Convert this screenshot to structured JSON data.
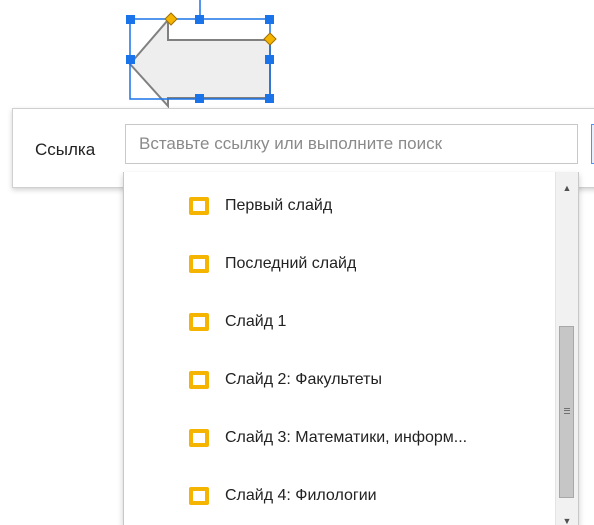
{
  "link_bubble": {
    "label": "Ссылка",
    "input_value": "",
    "input_placeholder": "Вставьте ссылку или выполните поиск"
  },
  "suggestions": [
    {
      "label": "Первый слайд",
      "icon": "slide-icon"
    },
    {
      "label": "Последний слайд",
      "icon": "slide-icon"
    },
    {
      "label": "Слайд 1",
      "icon": "slide-icon"
    },
    {
      "label": "Слайд 2: Факультеты",
      "icon": "slide-icon"
    },
    {
      "label": "Слайд 3: Математики, информ...",
      "icon": "slide-icon"
    },
    {
      "label": "Слайд 4: Филологии",
      "icon": "slide-icon"
    }
  ],
  "scrollbar": {
    "up_arrow": "▲",
    "down_arrow": "▼",
    "position": 0.62
  },
  "colors": {
    "selection": "#1a73e8",
    "handle": "#1a73e8",
    "adjust_handle": "#f4b400",
    "shape_fill": "#eeeeee",
    "shape_stroke": "#808080",
    "slide_icon": "#f4b400"
  }
}
